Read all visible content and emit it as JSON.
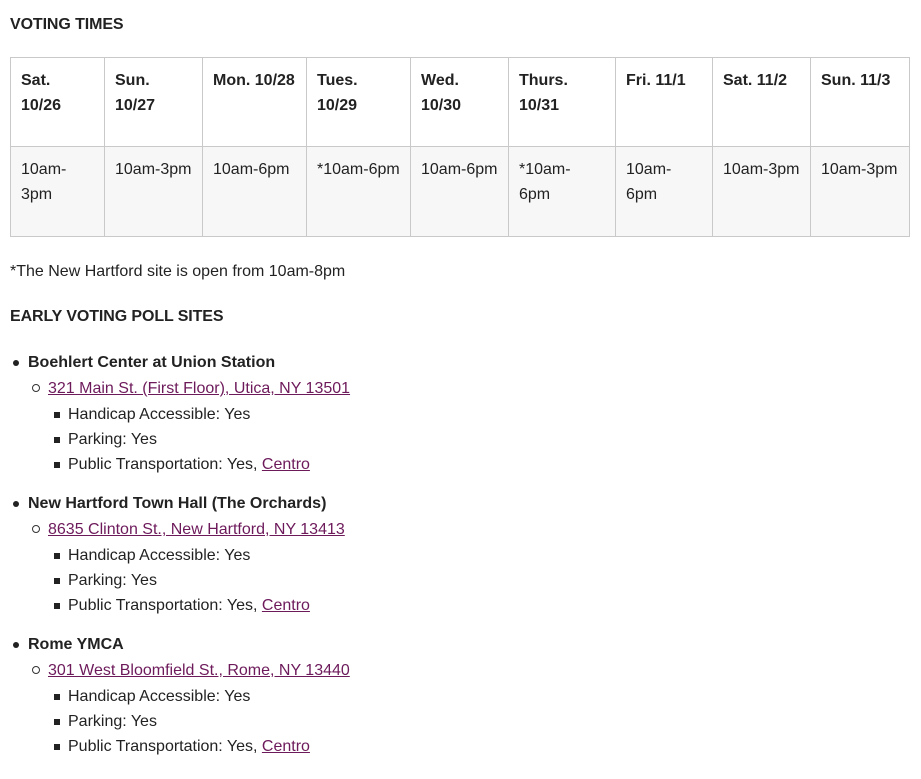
{
  "voting_times": {
    "heading": "VOTING TIMES",
    "columns": [
      {
        "day": "Sat. 10/26",
        "hours": "10am-3pm"
      },
      {
        "day": "Sun. 10/27",
        "hours": "10am-3pm"
      },
      {
        "day": "Mon. 10/28",
        "hours": "10am-6pm"
      },
      {
        "day": "Tues. 10/29",
        "hours": "*10am-6pm"
      },
      {
        "day": "Wed. 10/30",
        "hours": "10am-6pm"
      },
      {
        "day": "Thurs. 10/31",
        "hours": "*10am- 6pm"
      },
      {
        "day": "Fri. 11/1",
        "hours": "10am-6pm"
      },
      {
        "day": "Sat. 11/2",
        "hours": "10am-3pm"
      },
      {
        "day": "Sun. 11/3",
        "hours": "10am-3pm"
      }
    ],
    "note": "*The New Hartford site is open from 10am-8pm"
  },
  "poll_sites": {
    "heading": "EARLY VOTING POLL SITES",
    "sites": [
      {
        "name": "Boehlert Center at Union Station",
        "address": "321 Main St. (First Floor), Utica, NY 13501",
        "handicap": "Handicap Accessible: Yes",
        "parking": "Parking: Yes",
        "transport_prefix": "Public Transportation: Yes, ",
        "transport_link": "Centro"
      },
      {
        "name": "New Hartford Town Hall (The Orchards)",
        "address": "8635 Clinton St., New Hartford, NY 13413",
        "handicap": "Handicap Accessible: Yes",
        "parking": "Parking: Yes",
        "transport_prefix": "Public Transportation: Yes, ",
        "transport_link": "Centro"
      },
      {
        "name": "Rome YMCA",
        "address": "301 West Bloomfield St., Rome, NY 13440",
        "handicap": "Handicap Accessible: Yes",
        "parking": "Parking: Yes",
        "transport_prefix": "Public Transportation: Yes, ",
        "transport_link": "Centro"
      }
    ]
  },
  "colors": {
    "link": "#6d1a5b",
    "text": "#222222",
    "table_border": "#c9c9c9",
    "cell_bg": "#f7f7f7"
  }
}
